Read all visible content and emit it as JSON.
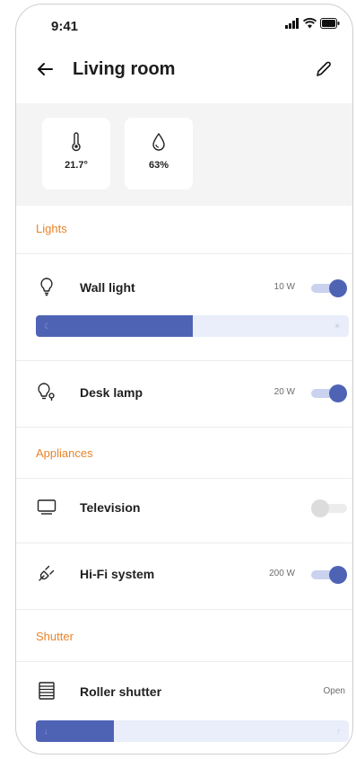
{
  "status_bar": {
    "time": "9:41"
  },
  "header": {
    "title": "Living room"
  },
  "sensors": {
    "temperature": "21.7°",
    "humidity": "63%"
  },
  "sections": {
    "lights": "Lights",
    "appliances": "Appliances",
    "shutter": "Shutter"
  },
  "devices": {
    "wall_light": {
      "label": "Wall light",
      "power": "10 W",
      "on": true,
      "brightness_fraction": 0.5
    },
    "desk_lamp": {
      "label": "Desk lamp",
      "power": "20 W",
      "on": true
    },
    "television": {
      "label": "Television",
      "on": false
    },
    "hifi": {
      "label": "Hi-Fi system",
      "power": "200 W",
      "on": true
    },
    "roller_shutter": {
      "label": "Roller shutter",
      "state": "Open",
      "position_fraction": 0.25
    }
  },
  "colors": {
    "accent": "#4f63b5",
    "section": "#e8842a",
    "track": "#e9eefa"
  },
  "icons": [
    "back-arrow-icon",
    "pencil-icon",
    "thermometer-icon",
    "droplet-icon",
    "bulb-icon",
    "desk-lamp-icon",
    "tv-icon",
    "plug-icon",
    "shutter-icon",
    "moon-icon",
    "sun-icon"
  ]
}
